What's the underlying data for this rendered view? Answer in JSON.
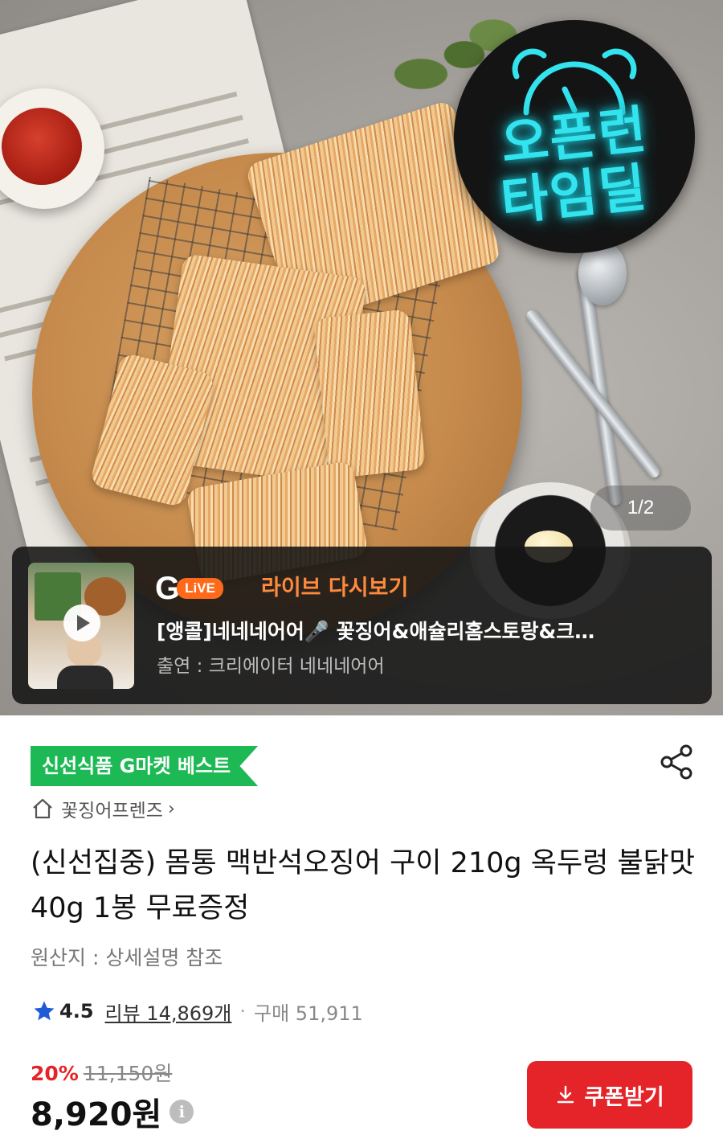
{
  "hero": {
    "badge_line1": "오픈런",
    "badge_line2": "타임딜",
    "page_indicator": "1/2"
  },
  "live": {
    "logo_g": "G",
    "logo_live": "LiVE",
    "replay_label": "라이브 다시보기",
    "title": "[앵콜]네네네어어🎤 꽃징어&애슐리홈스토랑&크…",
    "cast": "출연 : 크리에이터 네네네어어"
  },
  "product": {
    "best_badge": "신선식품 G마켓 베스트",
    "seller": "꽃징어프렌즈",
    "title": "(신선집중) 몸통 맥반석오징어 구이 210g 옥두렁 불닭맛 40g 1봉 무료증정",
    "origin": "원산지 : 상세설명 참조",
    "rating": "4.5",
    "review": "리뷰 14,869개",
    "dot": "·",
    "purchase": "구매 51,911",
    "discount": "20%",
    "original_price": "11,150원",
    "price": "8,920원",
    "coupon_label": "쿠폰받기"
  },
  "icons": {
    "share": "share-icon",
    "home": "home-icon",
    "star": "star-icon",
    "info": "info-icon",
    "download": "download-icon",
    "play": "play-icon"
  },
  "colors": {
    "accent_red": "#e5242a",
    "best_green": "#1db954",
    "live_orange": "#ff6a1a",
    "badge_neon": "#33e3ee",
    "star_blue": "#1f5bd6"
  }
}
